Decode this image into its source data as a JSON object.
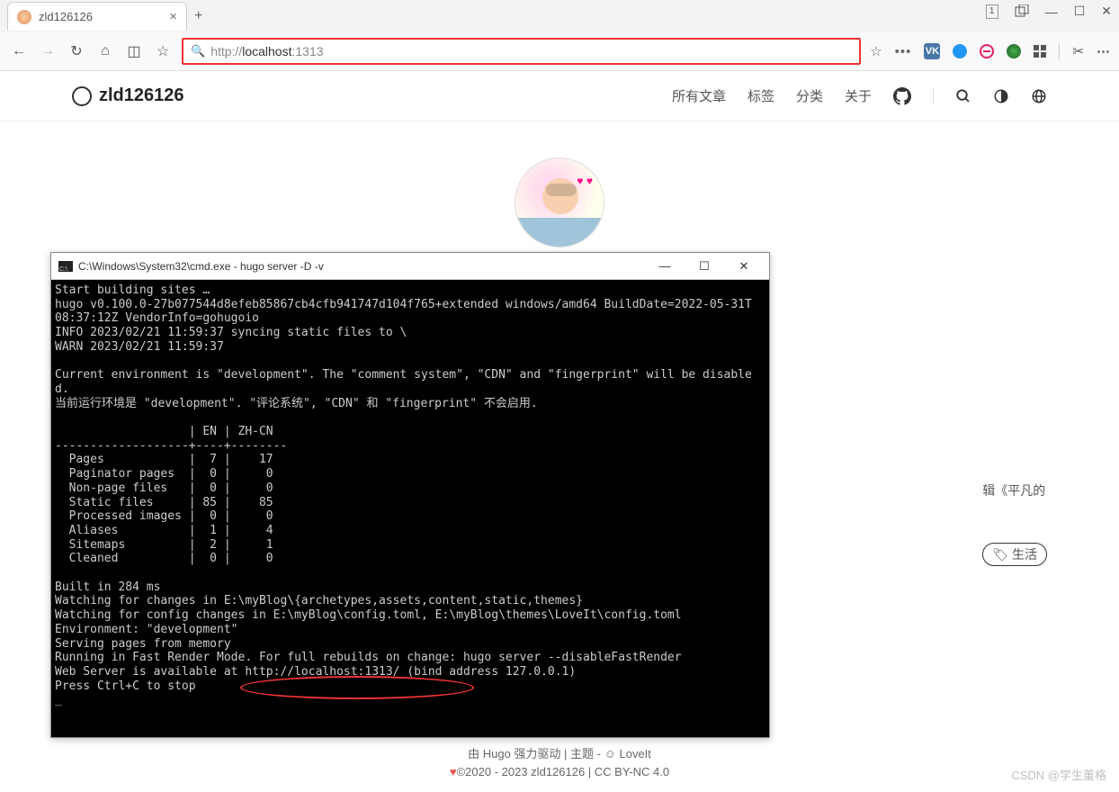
{
  "browser": {
    "tab_title": "zld126126",
    "new_tab_tooltip": "+",
    "url_prefix": "http://",
    "url_host": "localhost",
    "url_port": ":1313",
    "window_doc_badge": "1"
  },
  "site": {
    "title": "zld126126",
    "nav": {
      "all_posts": "所有文章",
      "tags": "标签",
      "categories": "分类",
      "about": "关于"
    }
  },
  "sidebar": {
    "edit_text": "辑《平凡的",
    "life_tag": "生活"
  },
  "terminal": {
    "title": "C:\\Windows\\System32\\cmd.exe - hugo  server -D -v",
    "body": "Start building sites …\nhugo v0.100.0-27b077544d8efeb85867cb4cfb941747d104f765+extended windows/amd64 BuildDate=2022-05-31T\n08:37:12Z VendorInfo=gohugoio\nINFO 2023/02/21 11:59:37 syncing static files to \\\nWARN 2023/02/21 11:59:37\n\nCurrent environment is \"development\". The \"comment system\", \"CDN\" and \"fingerprint\" will be disable\nd.\n当前运行环境是 \"development\". \"评论系统\", \"CDN\" 和 \"fingerprint\" 不会启用.\n\n                   | EN | ZH-CN\n-------------------+----+--------\n  Pages            |  7 |    17\n  Paginator pages  |  0 |     0\n  Non-page files   |  0 |     0\n  Static files     | 85 |    85\n  Processed images |  0 |     0\n  Aliases          |  1 |     4\n  Sitemaps         |  2 |     1\n  Cleaned          |  0 |     0\n\nBuilt in 284 ms\nWatching for changes in E:\\myBlog\\{archetypes,assets,content,static,themes}\nWatching for config changes in E:\\myBlog\\config.toml, E:\\myBlog\\themes\\LoveIt\\config.toml\nEnvironment: \"development\"\nServing pages from memory\nRunning in Fast Render Mode. For full rebuilds on change: hugo server --disableFastRender\nWeb Server is available at http://localhost:1313/ (bind address 127.0.0.1)\nPress Ctrl+C to stop\n_"
  },
  "footer": {
    "line1_prefix": "由 ",
    "line1_hugo": "Hugo",
    "line1_power": " 强力驱动",
    "line1_sep": " | ",
    "line1_theme": "主题 - ",
    "line1_loveit": "LoveIt",
    "line2_copy": "©2020 - 2023 zld126126",
    "line2_sep": " | ",
    "line2_license": "CC BY-NC 4.0"
  },
  "watermark": "CSDN @学生董格"
}
